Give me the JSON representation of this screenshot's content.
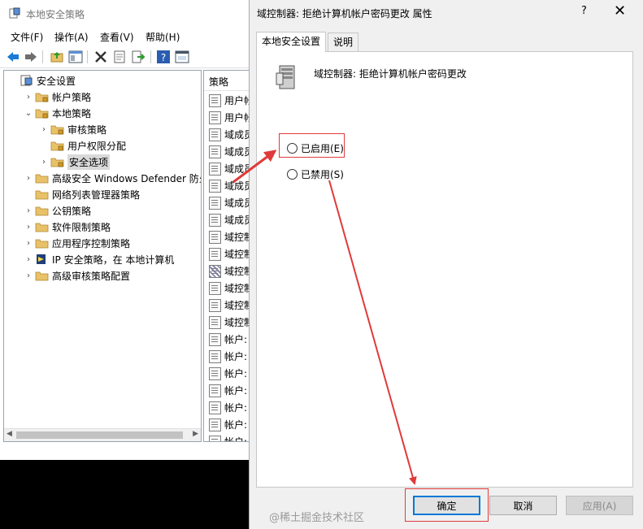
{
  "main_window": {
    "title": "本地安全策略",
    "menu": [
      "文件(F)",
      "操作(A)",
      "查看(V)",
      "帮助(H)"
    ],
    "toolbar_icons": [
      "back-arrow-icon",
      "forward-arrow-icon",
      "up-folder-icon",
      "show-hide-tree-icon",
      "delete-icon",
      "properties-icon",
      "export-icon",
      "help-icon",
      "console-icon"
    ],
    "tree": [
      {
        "label": "安全设置",
        "expander": "none"
      },
      {
        "label": "帐户策略",
        "expander": "collapsed"
      },
      {
        "label": "本地策略",
        "expander": "expanded"
      },
      {
        "label": "审核策略",
        "expander": "collapsed"
      },
      {
        "label": "用户权限分配",
        "expander": "none"
      },
      {
        "label": "安全选项",
        "expander": "collapsed"
      },
      {
        "label": "高级安全 Windows Defender 防火墙",
        "expander": "collapsed"
      },
      {
        "label": "网络列表管理器策略",
        "expander": "none"
      },
      {
        "label": "公钥策略",
        "expander": "collapsed"
      },
      {
        "label": "软件限制策略",
        "expander": "collapsed"
      },
      {
        "label": "应用程序控制策略",
        "expander": "collapsed"
      },
      {
        "label": "IP 安全策略，在 本地计算机",
        "expander": "collapsed"
      },
      {
        "label": "高级审核策略配置",
        "expander": "collapsed"
      }
    ],
    "list_header": "策略",
    "list_items": [
      "用户帐",
      "用户帐",
      "域成员",
      "域成员",
      "域成员",
      "域成员",
      "域成员",
      "域成员",
      "域控制",
      "域控制",
      "域控制",
      "域控制",
      "域控制",
      "域控制",
      "帐户:",
      "帐户:",
      "帐户:",
      "帐户:",
      "帐户:",
      "帐户:",
      "帐户:"
    ]
  },
  "dialog": {
    "title": "域控制器: 拒绝计算机帐户密码更改 属性",
    "help": "?",
    "close": "✕",
    "tabs": [
      "本地安全设置",
      "说明"
    ],
    "policy_name": "域控制器: 拒绝计算机帐户密码更改",
    "options": {
      "enabled": "已启用(E)",
      "disabled": "已禁用(S)"
    },
    "buttons": {
      "ok": "确定",
      "cancel": "取消",
      "apply": "应用(A)"
    }
  },
  "watermark": "@稀土掘金技术社区",
  "colors": {
    "annotation": "#e03a3a",
    "focus": "#0078d7",
    "folder": "#e8c169"
  }
}
